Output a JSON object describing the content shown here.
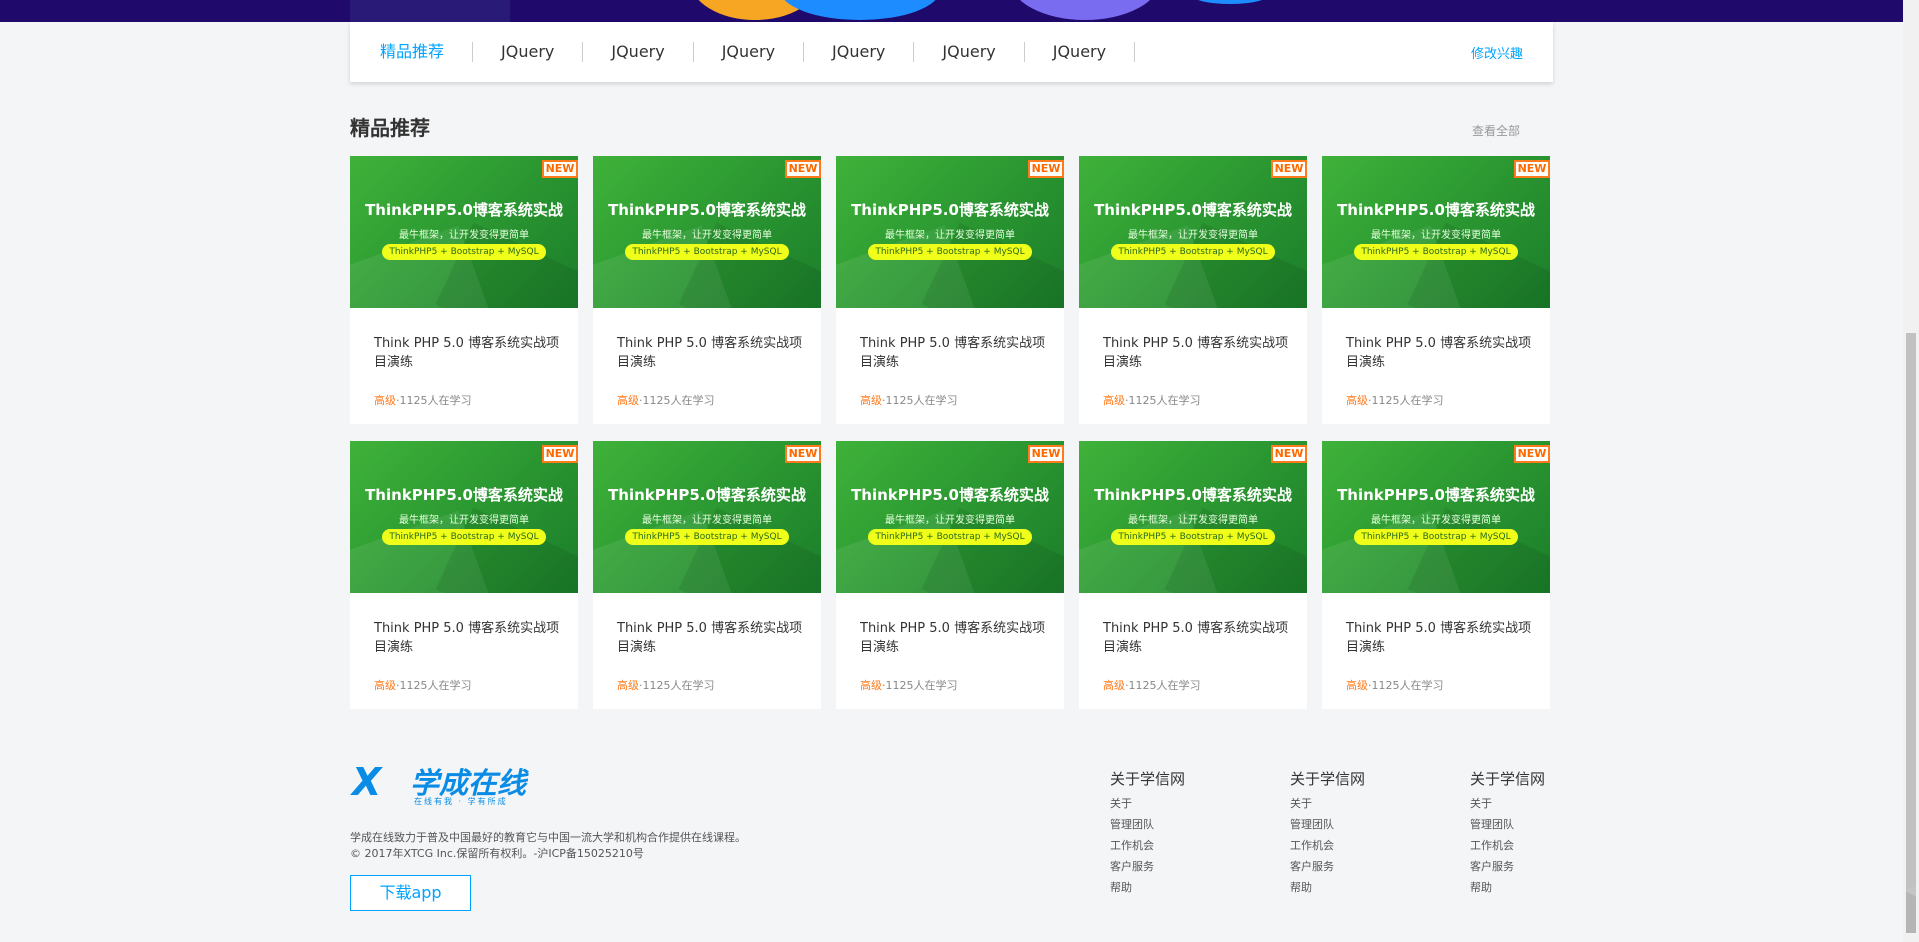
{
  "nav": {
    "tabs": [
      "精品推荐",
      "JQuery",
      "JQuery",
      "JQuery",
      "JQuery",
      "JQuery",
      "JQuery"
    ],
    "edit_label": "修改兴趣"
  },
  "section": {
    "title": "精品推荐",
    "view_all": "查看全部"
  },
  "courses": [
    {
      "badge": "NEW",
      "thumb_title": "ThinkPHP5.0博客系统实战",
      "thumb_sub": "最牛框架，让开发变得更简单",
      "thumb_pill": "ThinkPHP5 + Bootstrap + MySQL",
      "title": "Think PHP 5.0 博客系统实战项目演练",
      "level": "高级",
      "students": "·1125人在学习"
    },
    {
      "badge": "NEW",
      "thumb_title": "ThinkPHP5.0博客系统实战",
      "thumb_sub": "最牛框架，让开发变得更简单",
      "thumb_pill": "ThinkPHP5 + Bootstrap + MySQL",
      "title": "Think PHP 5.0 博客系统实战项目演练",
      "level": "高级",
      "students": "·1125人在学习"
    },
    {
      "badge": "NEW",
      "thumb_title": "ThinkPHP5.0博客系统实战",
      "thumb_sub": "最牛框架，让开发变得更简单",
      "thumb_pill": "ThinkPHP5 + Bootstrap + MySQL",
      "title": "Think PHP 5.0 博客系统实战项目演练",
      "level": "高级",
      "students": "·1125人在学习"
    },
    {
      "badge": "NEW",
      "thumb_title": "ThinkPHP5.0博客系统实战",
      "thumb_sub": "最牛框架，让开发变得更简单",
      "thumb_pill": "ThinkPHP5 + Bootstrap + MySQL",
      "title": "Think PHP 5.0 博客系统实战项目演练",
      "level": "高级",
      "students": "·1125人在学习"
    },
    {
      "badge": "NEW",
      "thumb_title": "ThinkPHP5.0博客系统实战",
      "thumb_sub": "最牛框架，让开发变得更简单",
      "thumb_pill": "ThinkPHP5 + Bootstrap + MySQL",
      "title": "Think PHP 5.0 博客系统实战项目演练",
      "level": "高级",
      "students": "·1125人在学习"
    },
    {
      "badge": "NEW",
      "thumb_title": "ThinkPHP5.0博客系统实战",
      "thumb_sub": "最牛框架，让开发变得更简单",
      "thumb_pill": "ThinkPHP5 + Bootstrap + MySQL",
      "title": "Think PHP 5.0 博客系统实战项目演练",
      "level": "高级",
      "students": "·1125人在学习"
    },
    {
      "badge": "NEW",
      "thumb_title": "ThinkPHP5.0博客系统实战",
      "thumb_sub": "最牛框架，让开发变得更简单",
      "thumb_pill": "ThinkPHP5 + Bootstrap + MySQL",
      "title": "Think PHP 5.0 博客系统实战项目演练",
      "level": "高级",
      "students": "·1125人在学习"
    },
    {
      "badge": "NEW",
      "thumb_title": "ThinkPHP5.0博客系统实战",
      "thumb_sub": "最牛框架，让开发变得更简单",
      "thumb_pill": "ThinkPHP5 + Bootstrap + MySQL",
      "title": "Think PHP 5.0 博客系统实战项目演练",
      "level": "高级",
      "students": "·1125人在学习"
    },
    {
      "badge": "NEW",
      "thumb_title": "ThinkPHP5.0博客系统实战",
      "thumb_sub": "最牛框架，让开发变得更简单",
      "thumb_pill": "ThinkPHP5 + Bootstrap + MySQL",
      "title": "Think PHP 5.0 博客系统实战项目演练",
      "level": "高级",
      "students": "·1125人在学习"
    },
    {
      "badge": "NEW",
      "thumb_title": "ThinkPHP5.0博客系统实战",
      "thumb_sub": "最牛框架，让开发变得更简单",
      "thumb_pill": "ThinkPHP5 + Bootstrap + MySQL",
      "title": "Think PHP 5.0 博客系统实战项目演练",
      "level": "高级",
      "students": "·1125人在学习"
    }
  ],
  "footer": {
    "logo_mark": "X",
    "logo_name": "学成在线",
    "logo_slogan": "在线有我 · 学有所成",
    "description": "学成在线致力于普及中国最好的教育它与中国一流大学和机构合作提供在线课程。",
    "copyright": "© 2017年XTCG Inc.保留所有权利。-沪ICP备15025210号",
    "download_label": "下载app",
    "columns": [
      {
        "heading": "关于学信网",
        "links": [
          "关于",
          "管理团队",
          "工作机会",
          "客户服务",
          "帮助"
        ]
      },
      {
        "heading": "关于学信网",
        "links": [
          "关于",
          "管理团队",
          "工作机会",
          "客户服务",
          "帮助"
        ]
      },
      {
        "heading": "关于学信网",
        "links": [
          "关于",
          "管理团队",
          "工作机会",
          "客户服务",
          "帮助"
        ]
      }
    ]
  },
  "colors": {
    "accent": "#00a4ff",
    "level": "#ff7a1a",
    "banner": "#1f0a6b"
  }
}
